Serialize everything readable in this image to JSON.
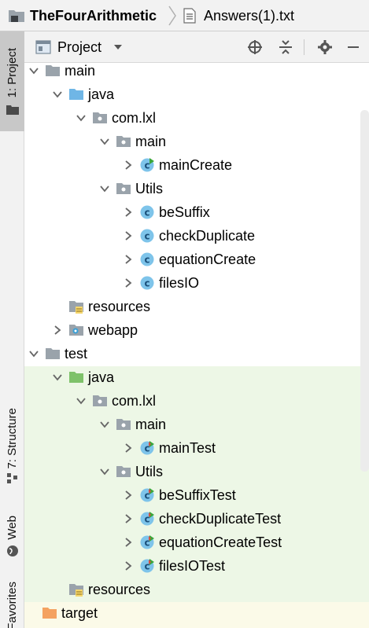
{
  "breadcrumb": {
    "project": "TheFourArithmetic",
    "file": "Answers(1).txt"
  },
  "tool_windows": {
    "project": "1: Project",
    "structure": "7: Structure",
    "web": "Web",
    "favorites": "Favorites"
  },
  "panel": {
    "view_title": "Project"
  },
  "tree": [
    {
      "label": "main",
      "icon": "folder-gray-icon",
      "expand": "expanded"
    },
    {
      "label": "java",
      "icon": "folder-blue-icon",
      "expand": "expanded"
    },
    {
      "label": "com.lxl",
      "icon": "package-icon",
      "expand": "expanded"
    },
    {
      "label": "main",
      "icon": "package-icon",
      "expand": "expanded"
    },
    {
      "label": "mainCreate",
      "icon": "class-main-icon",
      "expand": "collapsed"
    },
    {
      "label": "Utils",
      "icon": "package-icon",
      "expand": "expanded"
    },
    {
      "label": "beSuffix",
      "icon": "class-icon",
      "expand": "collapsed"
    },
    {
      "label": "checkDuplicate",
      "icon": "class-icon",
      "expand": "collapsed"
    },
    {
      "label": "equationCreate",
      "icon": "class-icon",
      "expand": "collapsed"
    },
    {
      "label": "filesIO",
      "icon": "class-icon",
      "expand": "collapsed"
    },
    {
      "label": "resources",
      "icon": "resources-folder-icon",
      "expand": "none"
    },
    {
      "label": "webapp",
      "icon": "web-folder-icon",
      "expand": "collapsed"
    },
    {
      "label": "test",
      "icon": "folder-gray-icon",
      "expand": "expanded"
    },
    {
      "label": "java",
      "icon": "folder-green-icon",
      "expand": "expanded"
    },
    {
      "label": "com.lxl",
      "icon": "package-icon",
      "expand": "expanded"
    },
    {
      "label": "main",
      "icon": "package-icon",
      "expand": "expanded"
    },
    {
      "label": "mainTest",
      "icon": "test-class-icon",
      "expand": "collapsed"
    },
    {
      "label": "Utils",
      "icon": "package-icon",
      "expand": "expanded"
    },
    {
      "label": "beSuffixTest",
      "icon": "test-class-icon",
      "expand": "collapsed"
    },
    {
      "label": "checkDuplicateTest",
      "icon": "test-class-icon",
      "expand": "collapsed"
    },
    {
      "label": "equationCreateTest",
      "icon": "test-class-icon",
      "expand": "collapsed"
    },
    {
      "label": "filesIOTest",
      "icon": "test-class-icon",
      "expand": "collapsed"
    },
    {
      "label": "resources",
      "icon": "resources-folder-icon",
      "expand": "none"
    },
    {
      "label": "target",
      "icon": "folder-orange-icon",
      "expand": "none"
    }
  ],
  "colors": {
    "accent_blue": "#389fd6",
    "test_bg": "#edf7e6",
    "excluded_bg": "#fbfae8",
    "target_folder": "#f4a261"
  }
}
